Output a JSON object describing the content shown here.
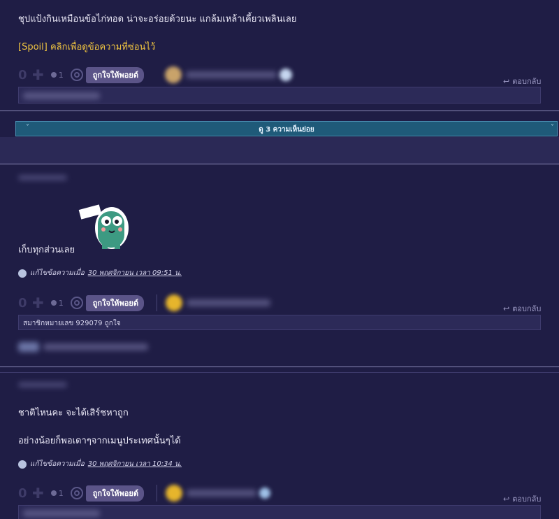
{
  "comment1": {
    "text": "ชุปแป้งกินเหมือนข้อไก่ทอด น่าจะอร่อยด้วยนะ แกล้มเหล้าเคี้ยวเพลินเลย",
    "spoil": "[Spoil] คลิกเพื่อดูข้อความที่ซ่อนไว้",
    "votes": "0",
    "emotion_count": "1",
    "like_label": "ถูกใจให้พอยต์",
    "reply_label": "ตอบกลับ"
  },
  "subcomments": {
    "label": "ดู 3 ความเห็นย่อย"
  },
  "comment2": {
    "text": "เก็บทุกส่วนเลย",
    "edited_label": "แก้ไขข้อความเมื่อ",
    "edited_date": "30 พฤศจิกายน เวลา 09:51 น.",
    "votes": "0",
    "emotion_count": "1",
    "like_label": "ถูกใจให้พอยต์",
    "reply_label": "ตอบกลับ",
    "liked_by": "สมาชิกหมายเลข 929079 ถูกใจ"
  },
  "comment3": {
    "line1": "ชาติไหนคะ จะได้เสิร์ชหาถูก",
    "line2": "อย่างน้อยก็พอเดาๆจากเมนูประเทศนั้นๆได้",
    "edited_label": "แก้ไขข้อความเมื่อ",
    "edited_date": "30 พฤศจิกายน เวลา 10:34 น.",
    "votes": "0",
    "emotion_count": "1",
    "like_label": "ถูกใจให้พอยต์",
    "reply_label": "ตอบกลับ"
  },
  "colors": {
    "background": "#1f1d45",
    "spoil": "#f2c640",
    "subcomment_banner": "#1f5a79",
    "like_tag": "#5b5488"
  },
  "icons": [
    "plus-icon",
    "emotion-icon",
    "circle-icon",
    "reply-icon",
    "chevron-down-icon",
    "globe-icon"
  ]
}
